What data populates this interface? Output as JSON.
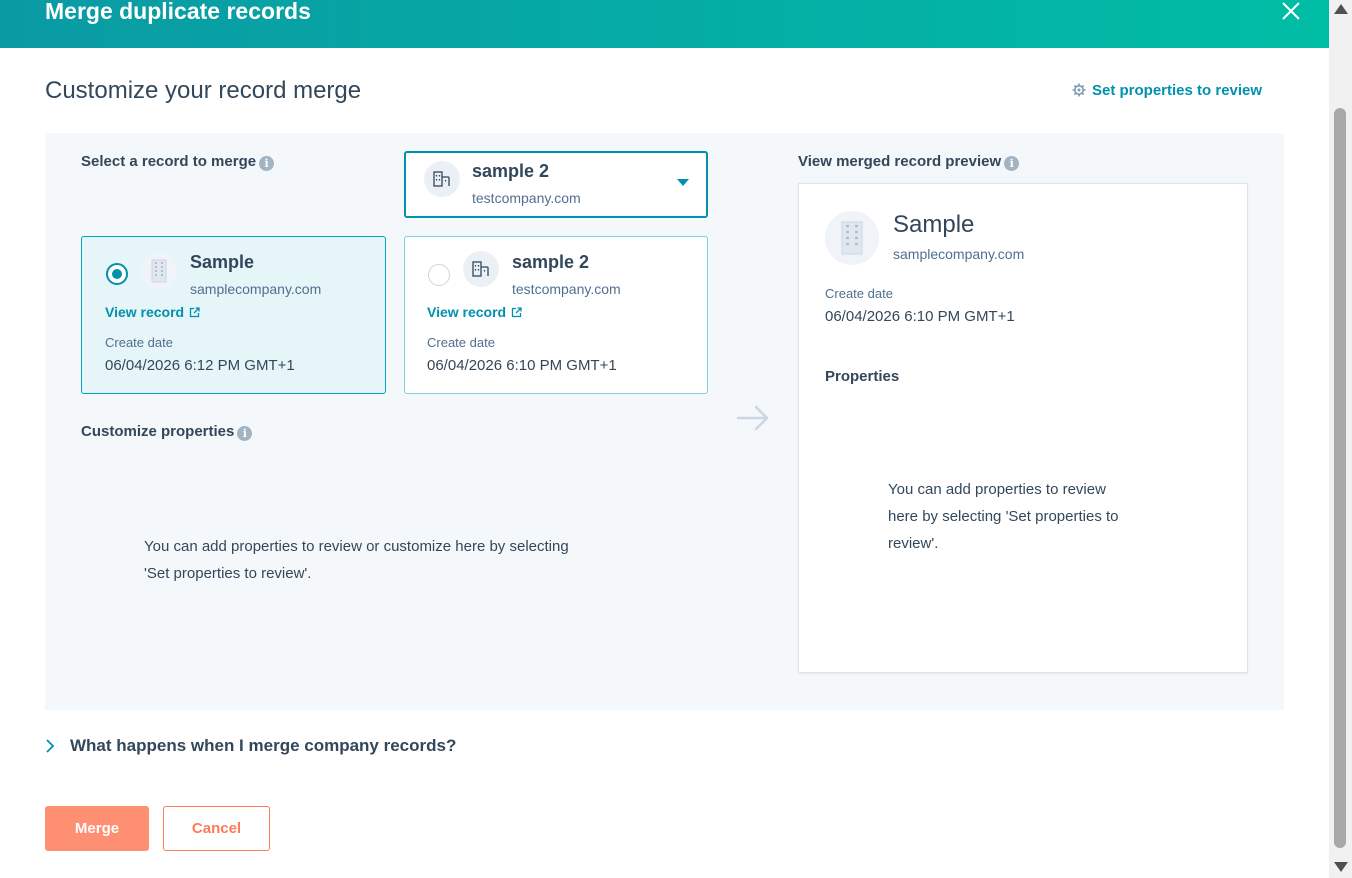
{
  "dialog": {
    "title": "Merge duplicate records",
    "close_icon": "close-icon"
  },
  "page": {
    "title": "Customize your record merge",
    "set_properties_link": "Set properties to review",
    "set_properties_icon": "gear-icon"
  },
  "select_section": {
    "label": "Select a record to merge",
    "info_icon": "info-icon",
    "dropdown": {
      "name": "sample 2",
      "domain": "testcompany.com",
      "icon": "building-icon",
      "caret_icon": "caret-down-icon"
    }
  },
  "records": [
    {
      "name": "Sample",
      "domain": "samplecompany.com",
      "view_label": "View record",
      "create_date_label": "Create date",
      "create_date": "06/04/2026 6:12 PM GMT+1",
      "selected": true
    },
    {
      "name": "sample 2",
      "domain": "testcompany.com",
      "view_label": "View record",
      "create_date_label": "Create date",
      "create_date": "06/04/2026 6:10 PM GMT+1",
      "selected": false
    }
  ],
  "customize_section": {
    "label": "Customize properties",
    "empty_line1": "You can add properties to review or customize here by selecting",
    "empty_line2": "'Set properties to review'."
  },
  "preview": {
    "label": "View merged record preview",
    "name": "Sample",
    "domain": "samplecompany.com",
    "create_date_label": "Create date",
    "create_date": "06/04/2026 6:10 PM GMT+1",
    "properties_label": "Properties",
    "empty_line1": "You can add properties to review",
    "empty_line2": "here by selecting 'Set properties to",
    "empty_line3": "review'."
  },
  "faq": {
    "label": "What happens when I merge company records?",
    "icon": "chevron-right-icon"
  },
  "buttons": {
    "merge": "Merge",
    "cancel": "Cancel"
  },
  "colors": {
    "header_start": "#0a9aa4",
    "header_end": "#00bda5",
    "accent": "#0091ae",
    "merge_button": "#ff8f73",
    "cancel_text": "#ff7a59"
  }
}
